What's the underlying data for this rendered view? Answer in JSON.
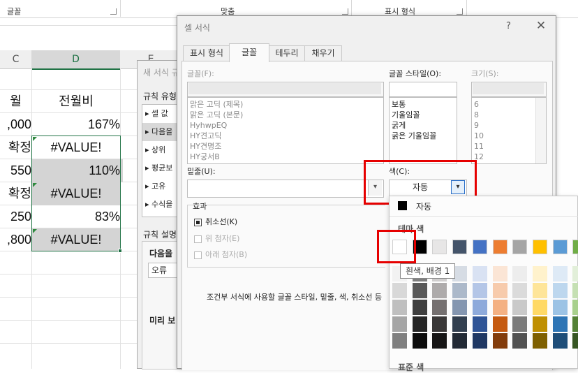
{
  "ribbon": {
    "font_group": "글꼴",
    "align_group": "맞춤",
    "number_group": "표시 형식"
  },
  "sheet": {
    "column_c": "C",
    "column_d": "D",
    "column_e": "E",
    "rows": [
      {
        "c": "월",
        "d": "전월비"
      },
      {
        "c": ",000",
        "d": "167%"
      },
      {
        "c": "확정",
        "d": "#VALUE!"
      },
      {
        "c": "550",
        "d": "110%"
      },
      {
        "c": "확정",
        "d": "#VALUE!"
      },
      {
        "c": "250",
        "d": "83%"
      },
      {
        "c": ",800",
        "d": "#VALUE!"
      }
    ]
  },
  "back_dialog": {
    "title": "새 서식 규",
    "rule_type_label": "규칙 유형",
    "rules": [
      "▸ 셀 값",
      "▸ 다음을",
      "▸ 상위",
      "▸ 평균보",
      "▸ 고유",
      "▸ 수식을"
    ],
    "rule_desc_label": "규칙 설명",
    "desc_heading": "다음을",
    "desc_select": "오류",
    "preview_label": "미리 보"
  },
  "dialog": {
    "title": "셀 서식",
    "help": "?",
    "close": "✕",
    "tabs": [
      "표시 형식",
      "글꼴",
      "테두리",
      "채우기"
    ],
    "font": {
      "label": "글꼴(F):",
      "value": "",
      "items": [
        "맑은 고딕 (제목)",
        "맑은 고딕 (본문)",
        "HyhwpEQ",
        "HY견고딕",
        "HY견명조",
        "HY궁서B"
      ]
    },
    "style": {
      "label": "글꼴 스타일(O):",
      "value": "",
      "items": [
        "보통",
        "기울임꼴",
        "굵게",
        "굵은 기울임꼴"
      ]
    },
    "size": {
      "label": "크기(S):",
      "value": "",
      "items": [
        "6",
        "8",
        "9",
        "10",
        "11",
        "12"
      ]
    },
    "underline_label": "밑줄(U):",
    "underline_value": "",
    "color_label": "색(C):",
    "color_value": "자동",
    "effects_label": "효과",
    "strike": "취소선(K)",
    "superscript": "위 첨자(E)",
    "subscript": "아래 첨자(B)",
    "footnote": "조건부 서식에 사용할 글꼴 스타일, 밑줄, 색, 취소선 등"
  },
  "picker": {
    "auto_label": "자동",
    "theme_label": "테마 색",
    "standard_label": "표준 색",
    "tooltip": "흰색, 배경 1",
    "theme_top": [
      "#ffffff",
      "#000000",
      "#e7e6e6",
      "#44546a",
      "#4472c4",
      "#ed7d31",
      "#a5a5a5",
      "#ffc000",
      "#5b9bd5",
      "#70ad47"
    ],
    "shades": [
      [
        "#f2f2f2",
        "#7f7f7f",
        "#d0cece",
        "#d6dce4",
        "#d9e2f3",
        "#fbe5d5",
        "#ededed",
        "#fff2cc",
        "#deeaf6",
        "#e2efd9"
      ],
      [
        "#d8d8d8",
        "#595959",
        "#aeabab",
        "#acb9ca",
        "#b4c6e7",
        "#f7cbac",
        "#dbdbdb",
        "#fee599",
        "#bdd7ee",
        "#c5e0b3"
      ],
      [
        "#bfbfbf",
        "#3f3f3f",
        "#757070",
        "#8496b0",
        "#8eaadb",
        "#f4b183",
        "#c9c9c9",
        "#ffd965",
        "#9cc3e5",
        "#a8d08d"
      ],
      [
        "#a5a5a5",
        "#262626",
        "#3a3838",
        "#323f4f",
        "#2f5496",
        "#c55a11",
        "#7b7b7b",
        "#bf8f00",
        "#2e75b5",
        "#538135"
      ],
      [
        "#7f7f7f",
        "#0c0c0c",
        "#171616",
        "#222a35",
        "#1f3864",
        "#833c0b",
        "#525252",
        "#7f6000",
        "#1e4e79",
        "#375623"
      ]
    ]
  }
}
